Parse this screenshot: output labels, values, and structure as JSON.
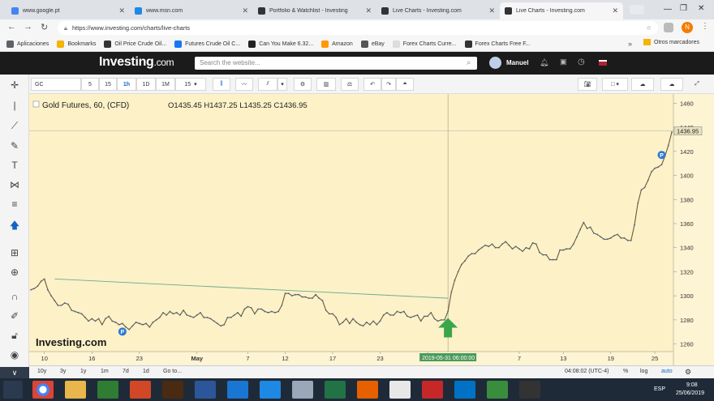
{
  "tabs": [
    {
      "title": "www.google.pt",
      "color": "#4285f4"
    },
    {
      "title": "www.msn.com",
      "color": "#1e88e5"
    },
    {
      "title": "Portfolio & Watchlist - Investing",
      "color": "#333"
    },
    {
      "title": "Live Charts - Investing.com",
      "color": "#333"
    },
    {
      "title": "Live Charts - Investing.com",
      "color": "#333"
    }
  ],
  "address": {
    "url": "https://www.investing.com/charts/live-charts"
  },
  "bookmarks": [
    {
      "label": "Aplicaciones",
      "color": "#5f6368"
    },
    {
      "label": "Bookmarks",
      "color": "#f4b400"
    },
    {
      "label": "Oil Price  Crude Oil...",
      "color": "#333"
    },
    {
      "label": "Futures Crude Oil C...",
      "color": "#1877f2"
    },
    {
      "label": "Can You Make 6.32...",
      "color": "#222"
    },
    {
      "label": "Amazon",
      "color": "#f90"
    },
    {
      "label": "eBay",
      "color": "#555"
    },
    {
      "label": "Forex Charts  Curre...",
      "color": "#ddd"
    },
    {
      "label": "Forex Charts  Free F...",
      "color": "#333"
    }
  ],
  "bookmarks_other": "Otros marcadores",
  "investing": {
    "logo": "Investing",
    "logo_suffix": ".com",
    "search_placeholder": "Search the website...",
    "user": "Manuel"
  },
  "toolbar": {
    "symbol": "GC",
    "intervals": [
      "5",
      "15",
      "1h",
      "1D",
      "1M",
      "15"
    ],
    "active_interval": "1h"
  },
  "legend": {
    "title": "Gold Futures, 60, (CFD)",
    "ohlc": "O1435.45  H1437.25  L1435.25  C1436.95"
  },
  "watermark": "Investing.com",
  "bottom": {
    "ranges": [
      "10y",
      "3y",
      "1y",
      "1m",
      "7d",
      "1d",
      "Go to..."
    ],
    "time": "04:08:02 (UTC-4)",
    "pct": "%",
    "log": "log",
    "auto": "auto"
  },
  "taskbar": {
    "time": "9:08",
    "date": "25/06/2019",
    "lang": "ESP"
  },
  "chart_data": {
    "type": "line",
    "title": "Gold Futures, 60, (CFD)",
    "ylim": [
      1255,
      1465
    ],
    "y_ticks": [
      1260,
      1280,
      1300,
      1320,
      1340,
      1360,
      1380,
      1400,
      1420,
      1440,
      1460
    ],
    "x_ticks": [
      "10",
      "16",
      "23",
      "May",
      "7",
      "12",
      "17",
      "23",
      "28",
      "7",
      "13",
      "19",
      "25"
    ],
    "x_tick_idx": [
      4,
      18,
      32,
      49,
      64,
      75,
      89,
      103,
      117,
      144,
      157,
      171,
      184
    ],
    "x_count": 190,
    "last_price": "1436.95",
    "cursor_label": "2019-05-31 06:00:00",
    "values": [
      1305,
      1306,
      1308,
      1312,
      1314,
      1305,
      1300,
      1296,
      1292,
      1292,
      1294,
      1293,
      1288,
      1287,
      1286,
      1285,
      1282,
      1279,
      1281,
      1279,
      1281,
      1276,
      1281,
      1283,
      1279,
      1278,
      1276,
      1277,
      1274,
      1272,
      1275,
      1278,
      1277,
      1276,
      1277,
      1274,
      1278,
      1280,
      1282,
      1286,
      1284,
      1287,
      1285,
      1286,
      1284,
      1288,
      1284,
      1283,
      1282,
      1284,
      1286,
      1282,
      1282,
      1281,
      1279,
      1277,
      1275,
      1276,
      1282,
      1282,
      1284,
      1286,
      1283,
      1289,
      1291,
      1290,
      1285,
      1289,
      1289,
      1287,
      1286,
      1287,
      1286,
      1287,
      1292,
      1302,
      1302,
      1300,
      1301,
      1301,
      1299,
      1299,
      1298,
      1298,
      1301,
      1298,
      1296,
      1288,
      1285,
      1285,
      1282,
      1276,
      1278,
      1281,
      1277,
      1281,
      1278,
      1276,
      1275,
      1278,
      1276,
      1279,
      1276,
      1279,
      1284,
      1286,
      1284,
      1284,
      1287,
      1286,
      1287,
      1283,
      1282,
      1283,
      1284,
      1279,
      1283,
      1283,
      1286,
      1281,
      1279,
      1280,
      1280,
      1287,
      1303,
      1313,
      1320,
      1326,
      1329,
      1333,
      1335,
      1335,
      1338,
      1340,
      1342,
      1341,
      1343,
      1340,
      1340,
      1343,
      1345,
      1342,
      1339,
      1341,
      1339,
      1337,
      1340,
      1339,
      1344,
      1343,
      1336,
      1334,
      1334,
      1330,
      1330,
      1330,
      1338,
      1338,
      1339,
      1339,
      1343,
      1349,
      1355,
      1361,
      1356,
      1357,
      1352,
      1351,
      1349,
      1347,
      1347,
      1348,
      1350,
      1351,
      1348,
      1348,
      1346,
      1346,
      1359,
      1377,
      1388,
      1390,
      1396,
      1403,
      1406,
      1407,
      1409,
      1416,
      1425,
      1436
    ],
    "trendline": [
      [
        7,
        1314
      ],
      [
        123,
        1298
      ]
    ],
    "events": [
      {
        "x": 27,
        "label": "P"
      },
      {
        "x": 186,
        "label": "P"
      }
    ],
    "arrow_x": 123
  }
}
